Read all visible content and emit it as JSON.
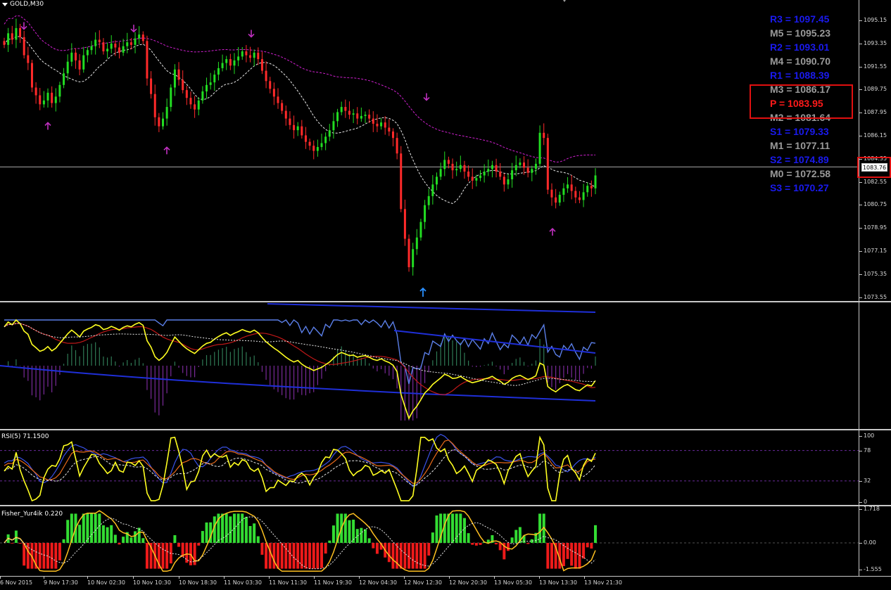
{
  "chart_title": "GOLD,M30",
  "colors": {
    "bull": "#22dd22",
    "bear": "#ff2a2a",
    "ma_magenta": "#d020d0",
    "ma_white": "#e8e8e8",
    "arrow_magenta": "#c030c0",
    "arrow_blue": "#2a90ff",
    "pivot_blue": "#1a1aee",
    "pivot_gray": "#9a9a9a",
    "pivot_red": "#ff1a1a",
    "highlight": "#e11010"
  },
  "price_axis": [
    "1095.15",
    "1093.35",
    "1091.55",
    "1089.75",
    "1087.95",
    "1086.15",
    "1084.35",
    "1082.55",
    "1080.75",
    "1078.95",
    "1077.15",
    "1075.35",
    "1073.55"
  ],
  "current_price": "1083.76",
  "pivots": [
    {
      "text": "R3 = 1097.45",
      "kind": "resistance"
    },
    {
      "text": "M5 = 1095.23",
      "kind": "mid"
    },
    {
      "text": "R2 = 1093.01",
      "kind": "resistance"
    },
    {
      "text": "M4 = 1090.70",
      "kind": "mid"
    },
    {
      "text": "R1 = 1088.39",
      "kind": "resistance"
    },
    {
      "text": "M3 = 1086.17",
      "kind": "mid"
    },
    {
      "text": "P  = 1083.95",
      "kind": "pivot"
    },
    {
      "text": "M2 = 1081.64",
      "kind": "mid"
    },
    {
      "text": "S1 = 1079.33",
      "kind": "support"
    },
    {
      "text": "M1 = 1077.11",
      "kind": "mid"
    },
    {
      "text": "S2 = 1074.89",
      "kind": "support"
    },
    {
      "text": "M0 = 1072.58",
      "kind": "mid"
    },
    {
      "text": "S3 = 1070.27",
      "kind": "support"
    }
  ],
  "rsi": {
    "title": "RSI(5) 71.1500",
    "axis": [
      "100",
      "78",
      "32",
      "0"
    ],
    "levels": [
      78,
      32
    ]
  },
  "fisher": {
    "title": "Fisher_Yur4ik 0.220",
    "axis": [
      "1.718",
      "0.00",
      "-1.555"
    ]
  },
  "time_axis": [
    "6 Nov 2015",
    "9 Nov 17:30",
    "10 Nov 02:30",
    "10 Nov 10:30",
    "10 Nov 18:30",
    "11 Nov 03:30",
    "11 Nov 11:30",
    "11 Nov 19:30",
    "12 Nov 04:30",
    "12 Nov 12:30",
    "12 Nov 20:30",
    "13 Nov 05:30",
    "13 Nov 13:30",
    "13 Nov 21:30"
  ],
  "chart_data": {
    "type": "candlestick",
    "symbol": "GOLD",
    "timeframe": "M30",
    "ylim": [
      1073.55,
      1095.15
    ],
    "close_series": [
      1093.2,
      1094.1,
      1093.6,
      1094.5,
      1093.8,
      1092.4,
      1091.8,
      1089.9,
      1089.3,
      1088.6,
      1088.9,
      1089.5,
      1088.7,
      1089.2,
      1090.1,
      1091.0,
      1091.9,
      1092.6,
      1092.0,
      1091.3,
      1092.4,
      1092.8,
      1093.1,
      1093.6,
      1093.4,
      1092.7,
      1092.9,
      1093.3,
      1093.0,
      1092.6,
      1093.1,
      1093.4,
      1093.2,
      1093.7,
      1094.0,
      1093.5,
      1090.6,
      1089.4,
      1087.6,
      1086.9,
      1087.5,
      1088.4,
      1089.9,
      1091.3,
      1090.5,
      1089.7,
      1089.1,
      1088.6,
      1088.2,
      1088.9,
      1089.6,
      1090.1,
      1090.3,
      1090.9,
      1091.4,
      1091.8,
      1092.1,
      1091.6,
      1092.0,
      1092.3,
      1092.7,
      1092.4,
      1092.2,
      1092.6,
      1092.1,
      1091.2,
      1090.4,
      1089.8,
      1089.2,
      1088.7,
      1088.1,
      1087.5,
      1087.0,
      1086.6,
      1086.9,
      1086.2,
      1085.7,
      1085.4,
      1085.0,
      1085.3,
      1085.6,
      1086.1,
      1086.6,
      1087.3,
      1088.0,
      1088.4,
      1088.1,
      1087.8,
      1087.9,
      1087.5,
      1087.7,
      1087.8,
      1087.5,
      1087.1,
      1086.9,
      1087.2,
      1086.8,
      1086.5,
      1086.0,
      1084.8,
      1080.5,
      1078.2,
      1076.0,
      1077.4,
      1078.3,
      1079.5,
      1080.8,
      1081.5,
      1082.4,
      1083.0,
      1083.6,
      1084.3,
      1084.0,
      1083.5,
      1083.6,
      1083.9,
      1083.4,
      1083.0,
      1082.7,
      1082.9,
      1083.1,
      1083.4,
      1083.6,
      1083.9,
      1083.4,
      1083.0,
      1082.4,
      1082.8,
      1083.5,
      1083.9,
      1084.1,
      1083.7,
      1083.3,
      1083.6,
      1084.0,
      1086.4,
      1086.0,
      1082.0,
      1081.4,
      1081.0,
      1081.6,
      1082.1,
      1082.4,
      1081.9,
      1081.4,
      1081.2,
      1081.8,
      1082.3,
      1082.1,
      1083.1
    ]
  }
}
